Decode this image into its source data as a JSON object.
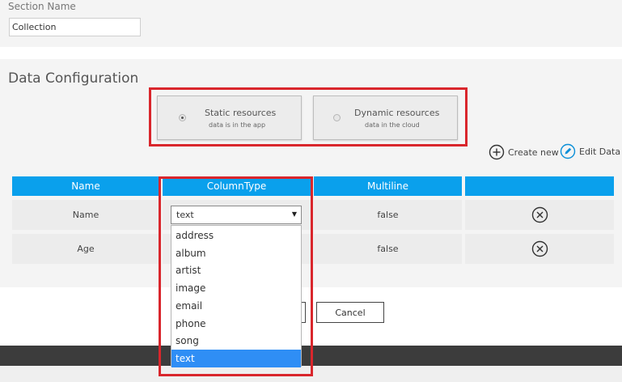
{
  "section": {
    "label": "Section Name",
    "value": "Collection"
  },
  "data_config": {
    "title": "Data Configuration",
    "static": {
      "title": "Static resources",
      "subtitle": "data is in the app",
      "selected": true
    },
    "dynamic": {
      "title": "Dynamic resources",
      "subtitle": "data in the cloud",
      "selected": false
    },
    "create_label": "Create new",
    "edit_label": "Edit Data"
  },
  "table": {
    "headers": [
      "Name",
      "ColumnType",
      "Multiline",
      ""
    ],
    "rows": [
      {
        "name": "Name",
        "type": "text",
        "multiline": "false"
      },
      {
        "name": "Age",
        "multiline": "false"
      }
    ]
  },
  "dropdown": {
    "options": [
      "address",
      "album",
      "artist",
      "image",
      "email",
      "phone",
      "song",
      "text"
    ],
    "selected": "text"
  },
  "buttons": {
    "cancel": "Cancel"
  },
  "colors": {
    "header_blue": "#0aa0ec",
    "highlight_red": "#d9262c",
    "selected_option": "#2f8ef5"
  }
}
